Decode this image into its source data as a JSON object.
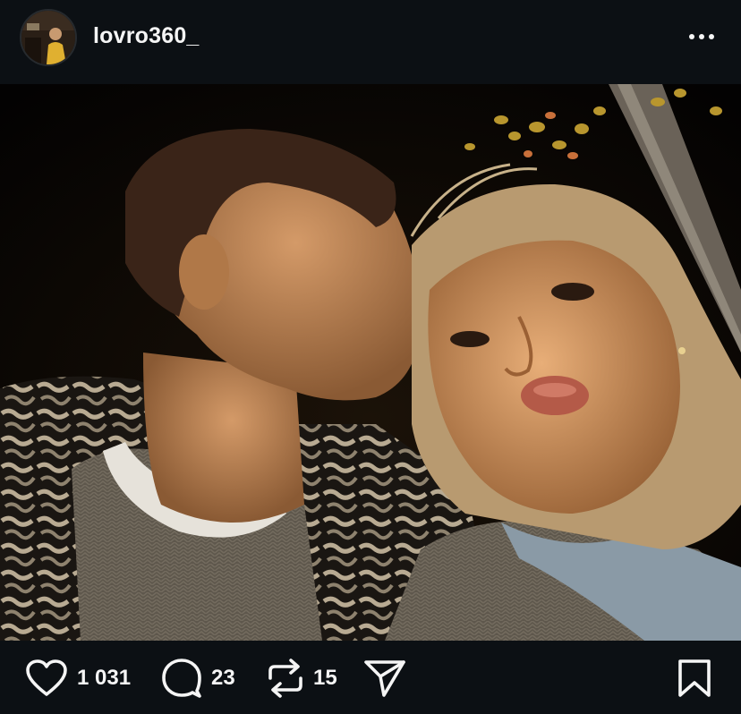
{
  "post": {
    "username": "lovro360_",
    "avatar_icon": "profile-avatar",
    "more_icon": "more-options-icon"
  },
  "actions": {
    "likes": "1 031",
    "comments": "23",
    "reposts": "15"
  },
  "colors": {
    "background": "#0c1014",
    "text": "#f5f5f5"
  }
}
